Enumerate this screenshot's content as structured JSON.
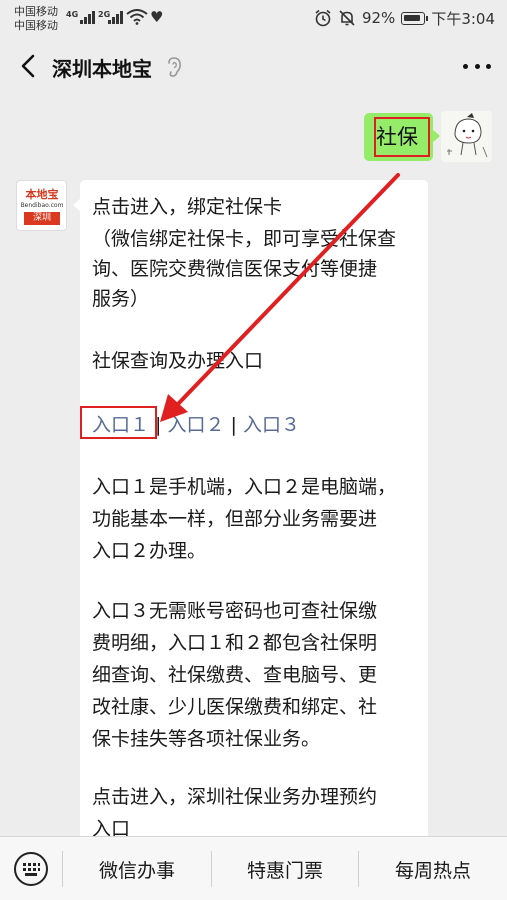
{
  "status_bar": {
    "carrier_1": "中国移动",
    "carrier_2": "中国移动",
    "net_1": "4G",
    "net_2": "2G",
    "battery_percent": "92%",
    "time": "下午3:04",
    "icons": [
      "alarm-icon",
      "mute-icon",
      "battery-icon",
      "wifi-icon",
      "heart-icon"
    ]
  },
  "header": {
    "title": "深圳本地宝",
    "icons": [
      "back-icon",
      "ear-icon",
      "more-icon"
    ]
  },
  "chat": {
    "user_message": "社保",
    "bot_avatar": {
      "logo_top": "本地宝",
      "logo_mid": "Bendibao.com",
      "logo_bottom": "深圳"
    },
    "bot_message": {
      "link_bind_card": "点击进入，绑定社保卡",
      "desc_lines": [
        "（微信绑定社保卡，即可享受社保查",
        "询、医院交费微信医保支付等便捷",
        "服务）"
      ],
      "query_title": "社保查询及办理入口",
      "entry_1": "入口１",
      "sep_1": " | ",
      "entry_2": "入口２",
      "sep_2": " | ",
      "entry_3": "入口３",
      "para_1": [
        "入口１是手机端，入口２是电脑端，",
        "功能基本一样，但部分业务需要进",
        "入口２办理。"
      ],
      "para_2": [
        "入口３无需账号密码也可查社保缴",
        "费明细，入口１和２都包含社保明",
        "细查询、社保缴费、查电脑号、更",
        "改社康、少儿医保缴费和绑定、社",
        "保卡挂失等各项社保业务。"
      ],
      "link_appointment": [
        "点击进入，深圳社保业务办理预约",
        "入口"
      ]
    }
  },
  "bottom_menu": {
    "items": [
      "微信办事",
      "特惠门票",
      "每周热点"
    ],
    "icons": [
      "keyboard-icon"
    ]
  },
  "annotation": {
    "box_color": "#e02020",
    "arrow_color": "#e02020"
  }
}
